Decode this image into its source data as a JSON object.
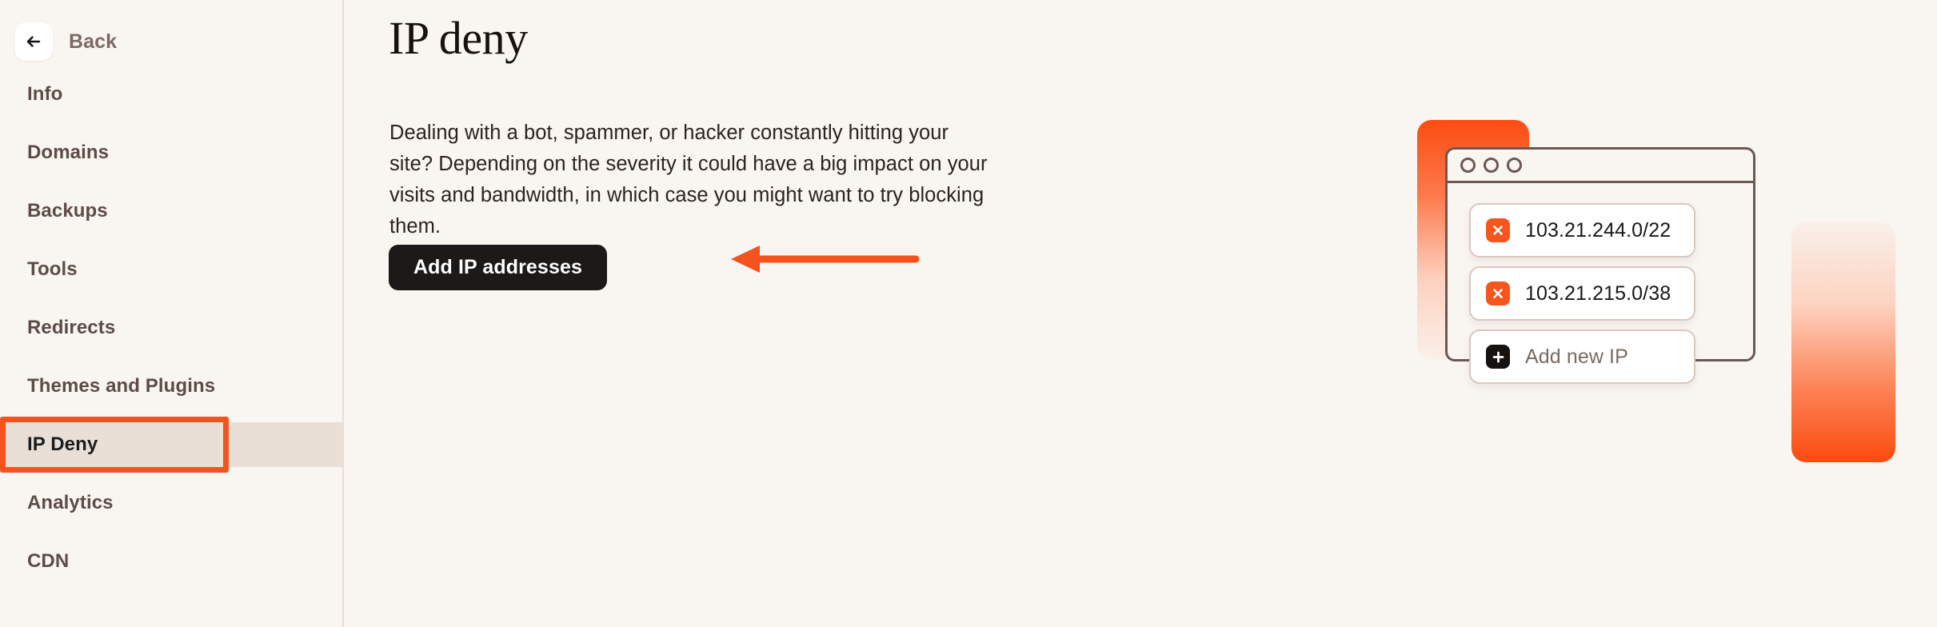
{
  "theme": {
    "background": "#f9f5f1",
    "accent_orange": "#f6521f",
    "badge_orange": "#f7551e",
    "dark": "#1c1a18",
    "sidebar_active_bg": "#e9dfd7",
    "text_muted": "#7b6a64"
  },
  "sidebar": {
    "back": {
      "label": "Back",
      "icon": "arrow-left-icon"
    },
    "items": [
      {
        "label": "Info",
        "active": false
      },
      {
        "label": "Domains",
        "active": false
      },
      {
        "label": "Backups",
        "active": false
      },
      {
        "label": "Tools",
        "active": false
      },
      {
        "label": "Redirects",
        "active": false
      },
      {
        "label": "Themes and Plugins",
        "active": false
      },
      {
        "label": "IP Deny",
        "active": true
      },
      {
        "label": "Analytics",
        "active": false
      },
      {
        "label": "CDN",
        "active": false
      }
    ]
  },
  "main": {
    "title": "IP deny",
    "description": "Dealing with a bot, spammer, or hacker constantly hitting your site? Depending on the severity it could have a big impact on your visits and bandwidth, in which case you might want to try blocking them.",
    "cta_label": "Add IP addresses",
    "annotation_arrow": "arrow-left-pointing-to-cta"
  },
  "illustration": {
    "window_dots": 3,
    "cards": [
      {
        "icon": "close-x-icon",
        "label": "103.21.244.0/22",
        "kind": "remove"
      },
      {
        "icon": "close-x-icon",
        "label": "103.21.215.0/38",
        "kind": "remove"
      },
      {
        "icon": "plus-icon",
        "label": "Add new IP",
        "kind": "add"
      }
    ]
  }
}
